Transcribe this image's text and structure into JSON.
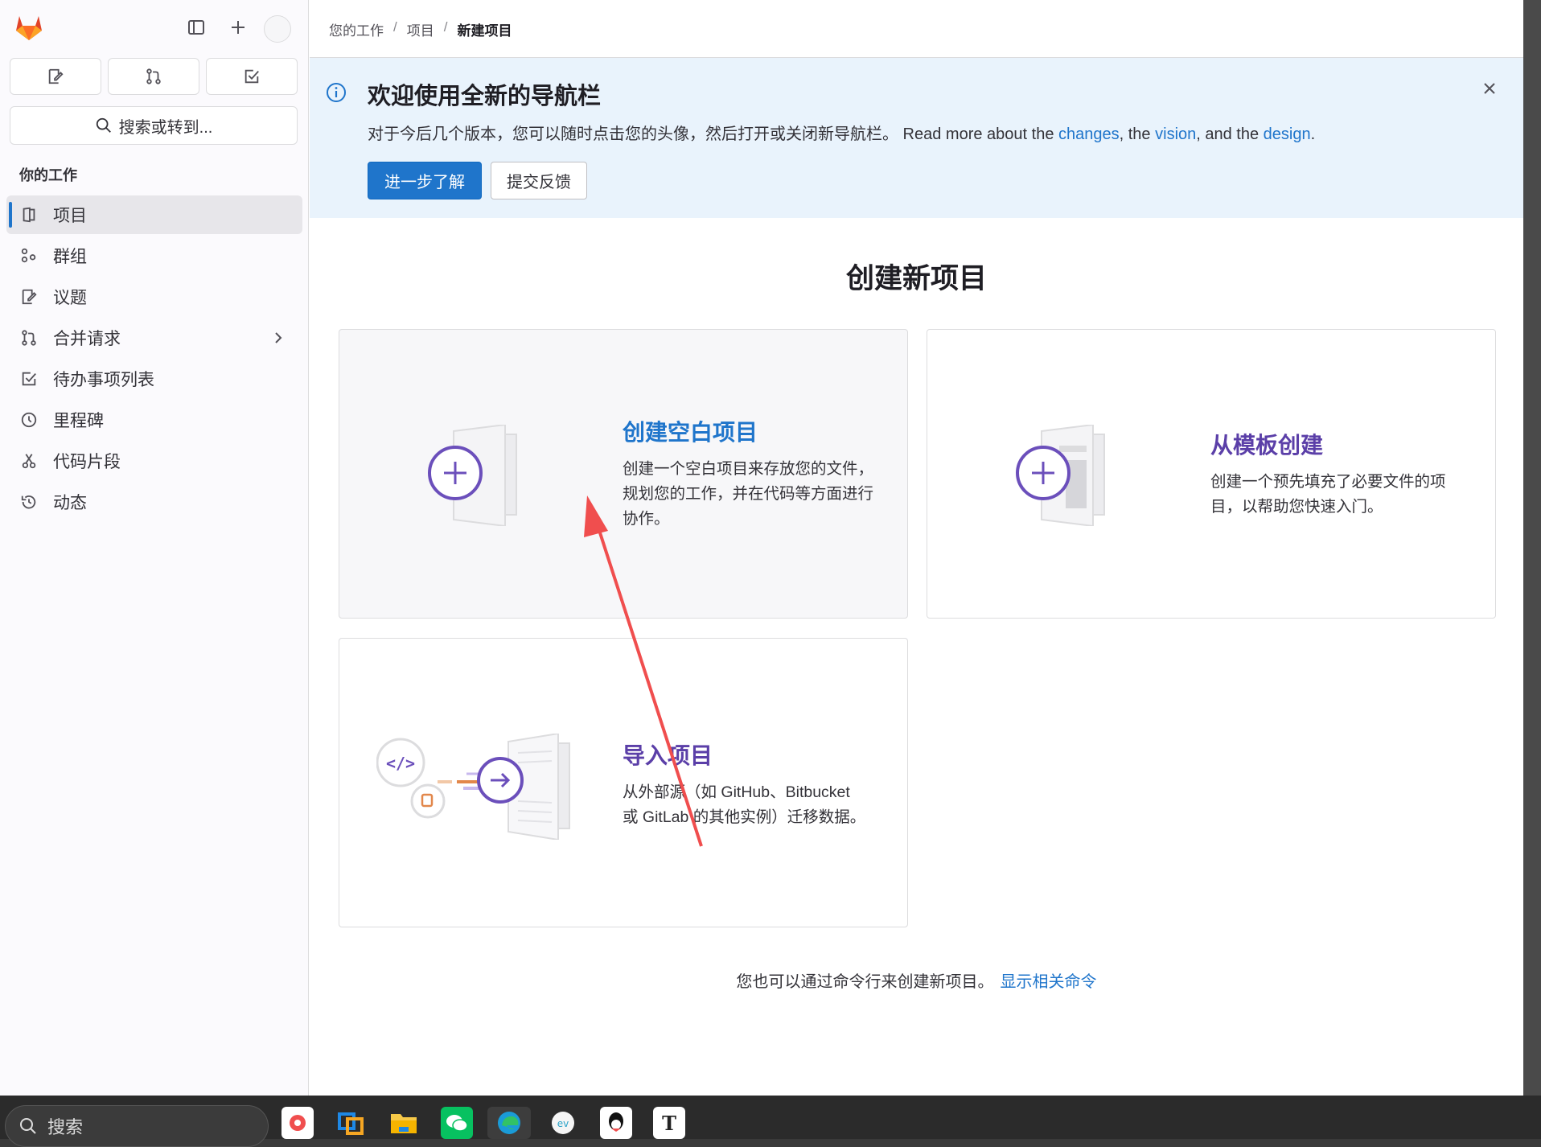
{
  "sidebar": {
    "search_label": "搜索或转到...",
    "section_label": "你的工作",
    "items": [
      {
        "label": "项目",
        "icon": "project-icon",
        "active": true
      },
      {
        "label": "群组",
        "icon": "group-icon"
      },
      {
        "label": "议题",
        "icon": "issues-icon"
      },
      {
        "label": "合并请求",
        "icon": "merge-request-icon"
      },
      {
        "label": "待办事项列表",
        "icon": "todo-icon"
      },
      {
        "label": "里程碑",
        "icon": "milestone-icon"
      },
      {
        "label": "代码片段",
        "icon": "snippet-icon"
      },
      {
        "label": "动态",
        "icon": "history-icon"
      }
    ]
  },
  "breadcrumb": [
    "您的工作",
    "项目",
    "新建项目"
  ],
  "banner": {
    "title": "欢迎使用全新的导航栏",
    "text_prefix": "对于今后几个版本，您可以随时点击您的头像，然后打开或关闭新导航栏。 Read more about the ",
    "link_changes": "changes",
    "text_mid1": ", the ",
    "link_vision": "vision",
    "text_mid2": ", and the ",
    "link_design": "design",
    "text_end": ".",
    "primary_button": "进一步了解",
    "secondary_button": "提交反馈"
  },
  "page_title": "创建新项目",
  "cards": {
    "blank": {
      "title": "创建空白项目",
      "desc_lines": [
        "创建一个空白项目来存放您的文件，",
        "规划您的工作，并在代码等方面进行",
        "协作。"
      ]
    },
    "template": {
      "title": "从模板创建",
      "desc_lines": [
        "创建一个预先填充了必要文件的项",
        "目，以帮助您快速入门。"
      ]
    },
    "import": {
      "title": "导入项目",
      "desc_lines": [
        "从外部源（如 GitHub、Bitbucket",
        "或 GitLab 的其他实例）迁移数据。"
      ]
    }
  },
  "footer": {
    "text": "您也可以通过命令行来创建新项目。",
    "link": "显示相关命令"
  },
  "taskbar": {
    "search_placeholder": "搜索"
  },
  "colors": {
    "primary": "#1f75cb",
    "purple": "#6b4fbb",
    "annotation_arrow": "#f04e4e"
  }
}
